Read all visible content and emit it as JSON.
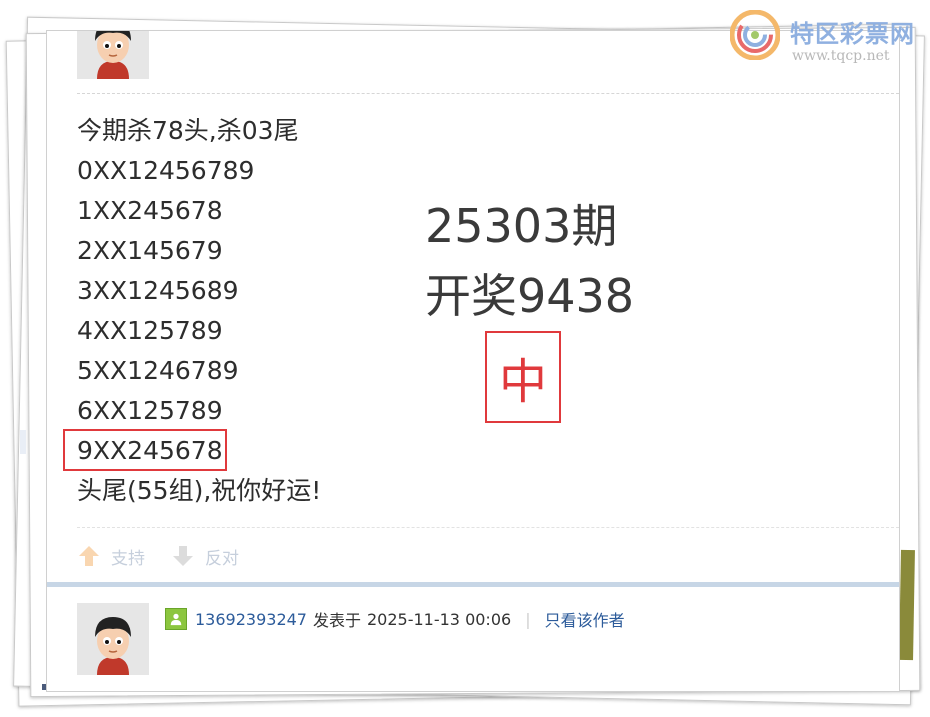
{
  "logo": {
    "name": "特区彩票网",
    "url": "www.tqcp.net"
  },
  "post_top": {
    "lines": [
      "今期杀78头,杀03尾",
      "0XX12456789",
      "1XX245678",
      "2XX145679",
      "3XX1245689",
      "4XX125789",
      "5XX1246789",
      "6XX125789",
      "9XX245678",
      "头尾(55组),祝你好运!"
    ],
    "highlighted_line": "9XX245678",
    "draw_period": "25303期",
    "draw_result": "开奖9438",
    "hit_mark": "中"
  },
  "votes": {
    "support_label": "支持",
    "oppose_label": "反对"
  },
  "post_bottom": {
    "username": "13692393247",
    "posted_label": "发表于",
    "posted_time": "2025-11-13 00:06",
    "separator": "|",
    "author_only_label": "只看该作者"
  },
  "colors": {
    "accent_red": "#e0393c",
    "link_blue": "#2c5b9a",
    "divider": "#c7d6e6"
  }
}
